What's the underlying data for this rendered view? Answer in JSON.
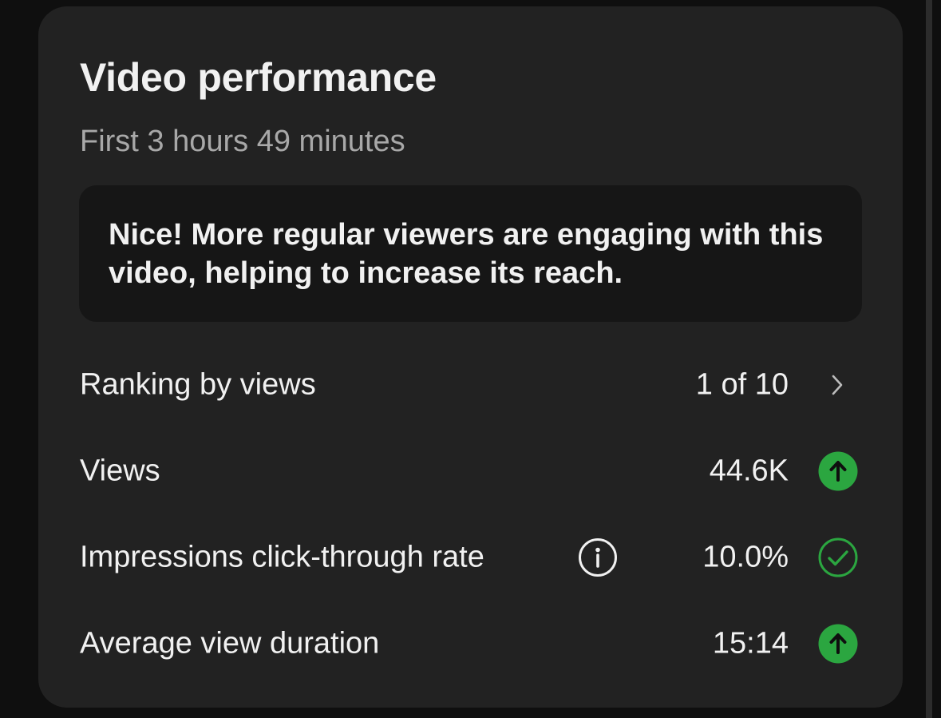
{
  "card": {
    "title": "Video performance",
    "subtitle": "First 3 hours 49 minutes",
    "insight": "Nice! More regular viewers are engaging with this video, helping to increase its reach."
  },
  "metrics": [
    {
      "label": "Ranking by views",
      "value": "1 of 10",
      "icon": "chevron-right-icon"
    },
    {
      "label": "Views",
      "value": "44.6K",
      "icon": "arrow-up-circle-icon"
    },
    {
      "label": "Impressions click-through rate",
      "value": "10.0%",
      "icon": "check-circle-icon"
    },
    {
      "label": "Average view duration",
      "value": "15:14",
      "icon": "arrow-up-circle-icon"
    }
  ],
  "colors": {
    "background": "#0f0f0f",
    "card": "#222222",
    "insight_box": "#161616",
    "text_primary": "#f1f1f1",
    "text_secondary": "#a8a8a8",
    "accent_green": "#2ba640"
  }
}
